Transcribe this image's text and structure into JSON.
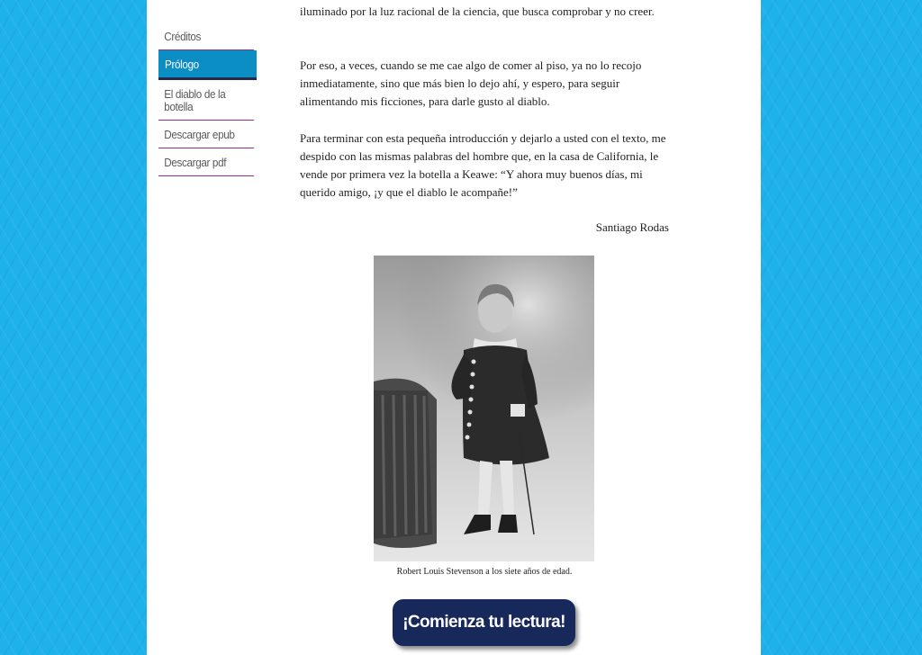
{
  "sidebar": {
    "items": [
      {
        "label": "Créditos",
        "active": false
      },
      {
        "label": "Prólogo",
        "active": true
      },
      {
        "label": "El diablo de la botella",
        "active": false
      },
      {
        "label": "Descargar epub",
        "active": false
      },
      {
        "label": "Descargar pdf",
        "active": false
      }
    ]
  },
  "content": {
    "p1": "iluminado por la luz racional de la ciencia, que busca comprobar y no creer.",
    "p2": "Por eso, a veces, cuando se me cae algo de comer al piso, ya no lo recojo inmediatamente, sino que más bien lo dejo ahí, y espero, para seguir alimentando mis ficciones, para darle gusto al diablo.",
    "p3": "Para terminar con esta pequeña introducción y dejarlo a usted con el texto, me despido con las mismas palabras del hombre que, en la casa de California, le vende por primera vez la botella a Keawe: “Y ahora muy buenos días, mi querido amigo, ¡y que el diablo le acompañe!”",
    "signature": "Santiago Rodas",
    "caption": "Robert Louis Stevenson a los siete años de edad.",
    "cta_label": "¡Comienza tu lectura!"
  },
  "colors": {
    "background": "#1eb1ea",
    "nav_active": "#0b8ec4",
    "nav_divider": "#9b2d8a",
    "cta": "#17285a"
  }
}
